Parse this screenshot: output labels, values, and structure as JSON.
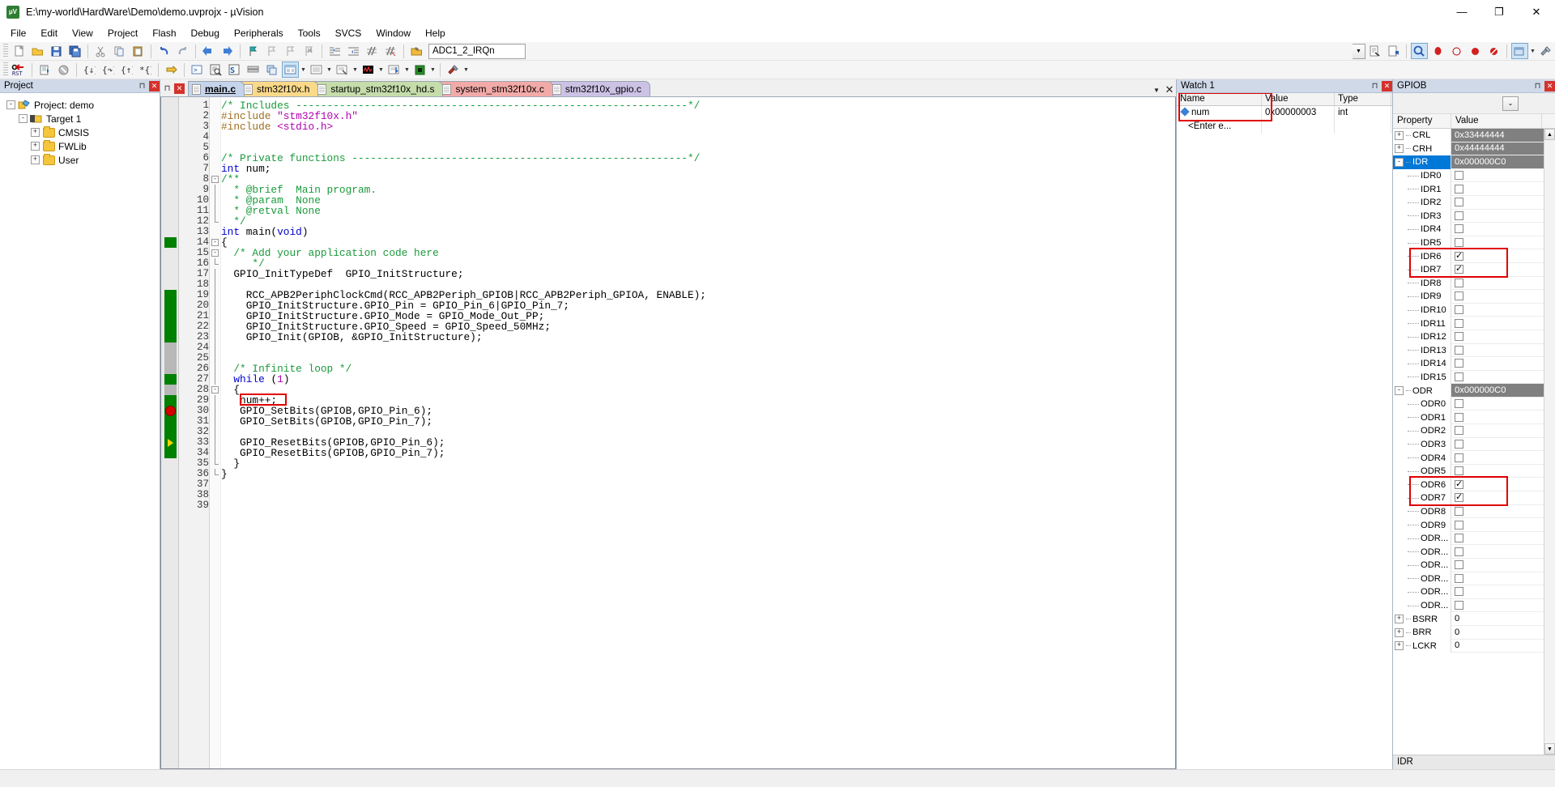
{
  "window": {
    "title": "E:\\my-world\\HardWare\\Demo\\demo.uvprojx - µVision",
    "logo_text": "µV",
    "minimize": "—",
    "maximize": "❐",
    "close": "✕"
  },
  "menu": [
    "File",
    "Edit",
    "View",
    "Project",
    "Flash",
    "Debug",
    "Peripherals",
    "Tools",
    "SVCS",
    "Window",
    "Help"
  ],
  "toolbar1": {
    "combo_value": "ADC1_2_IRQn",
    "icons": [
      "new-file-icon",
      "open-file-icon",
      "save-icon",
      "save-all-icon",
      "cut-icon",
      "copy-icon",
      "paste-icon",
      "undo-icon",
      "redo-icon",
      "navigate-back-icon",
      "navigate-forward-icon",
      "bookmark-toggle-icon",
      "bookmark-prev-icon",
      "bookmark-next-icon",
      "bookmark-clear-icon",
      "indent-icon",
      "outdent-icon",
      "comment-icon",
      "uncomment-icon",
      "insert-function-icon",
      "find-in-files-icon",
      "find-icon",
      "build-target-icon",
      "rebuild-icon",
      "batch-build-icon",
      "download-icon"
    ]
  },
  "toolbar2": {
    "icons": [
      "reset-cpu-icon",
      "debug-session-icon",
      "insert-bp-icon",
      "disable-bp-icon",
      "run-icon",
      "stop-icon",
      "step-into-icon",
      "step-over-icon",
      "step-out-icon",
      "run-to-cursor-icon",
      "show-statement-icon",
      "command-window-icon",
      "disassembly-icon",
      "symbols-icon",
      "registers-icon",
      "call-stack-icon",
      "watch-window-icon",
      "memory-window-icon",
      "serial-window-icon",
      "analysis-window-icon",
      "trace-icon",
      "system-viewer-icon",
      "toolbox-icon"
    ]
  },
  "project": {
    "panel_title": "Project",
    "pin_glyph": "⊓",
    "close_glyph": "✕",
    "tree": [
      {
        "label": "Project: demo",
        "level": 0,
        "expander": "-",
        "icon": "project-icon"
      },
      {
        "label": "Target 1",
        "level": 1,
        "expander": "-",
        "icon": "target-icon"
      },
      {
        "label": "CMSIS",
        "level": 2,
        "expander": "+",
        "icon": "folder-icon"
      },
      {
        "label": "FWLib",
        "level": 2,
        "expander": "+",
        "icon": "folder-icon"
      },
      {
        "label": "User",
        "level": 2,
        "expander": "+",
        "icon": "folder-icon"
      }
    ]
  },
  "editor": {
    "close_glyph": "✕",
    "dropdown_glyph": "▼",
    "tabs": [
      {
        "label": "main.c",
        "color": "#c5d4ea",
        "active": true
      },
      {
        "label": "stm32f10x.h",
        "color": "#fbd98a",
        "active": false
      },
      {
        "label": "startup_stm32f10x_hd.s",
        "color": "#c5dcab",
        "active": false
      },
      {
        "label": "system_stm32f10x.c",
        "color": "#f2aaa8",
        "active": false
      },
      {
        "label": "stm32f10x_gpio.c",
        "color": "#ccc2e5",
        "active": false
      }
    ],
    "lines": [
      {
        "n": 1,
        "tokens": [
          {
            "t": "/* Includes ---------------------------------------------------------------*/",
            "c": "cm"
          }
        ],
        "mark": "none",
        "fold": ""
      },
      {
        "n": 2,
        "tokens": [
          {
            "t": "#include ",
            "c": "pp"
          },
          {
            "t": "\"stm32f10x.h\"",
            "c": "str"
          }
        ],
        "mark": "none",
        "fold": ""
      },
      {
        "n": 3,
        "tokens": [
          {
            "t": "#include ",
            "c": "pp"
          },
          {
            "t": "<stdio.h>",
            "c": "str"
          }
        ],
        "mark": "none",
        "fold": ""
      },
      {
        "n": 4,
        "tokens": [],
        "mark": "none",
        "fold": ""
      },
      {
        "n": 5,
        "tokens": [],
        "mark": "none",
        "fold": ""
      },
      {
        "n": 6,
        "tokens": [
          {
            "t": "/* Private functions ------------------------------------------------------*/",
            "c": "cm"
          }
        ],
        "mark": "none",
        "fold": ""
      },
      {
        "n": 7,
        "tokens": [
          {
            "t": "int ",
            "c": "kw"
          },
          {
            "t": "num;",
            "c": "plain"
          }
        ],
        "mark": "none",
        "fold": ""
      },
      {
        "n": 8,
        "tokens": [
          {
            "t": "/**",
            "c": "cm"
          }
        ],
        "mark": "none",
        "fold": "open"
      },
      {
        "n": 9,
        "tokens": [
          {
            "t": "  * @brief  Main program.",
            "c": "cm"
          }
        ],
        "mark": "none",
        "fold": "bar"
      },
      {
        "n": 10,
        "tokens": [
          {
            "t": "  * @param  None",
            "c": "cm"
          }
        ],
        "mark": "none",
        "fold": "bar"
      },
      {
        "n": 11,
        "tokens": [
          {
            "t": "  * @retval None",
            "c": "cm"
          }
        ],
        "mark": "none",
        "fold": "bar"
      },
      {
        "n": 12,
        "tokens": [
          {
            "t": "  */",
            "c": "cm"
          }
        ],
        "mark": "none",
        "fold": "end"
      },
      {
        "n": 13,
        "tokens": [
          {
            "t": "int ",
            "c": "kw"
          },
          {
            "t": "main(",
            "c": "plain"
          },
          {
            "t": "void",
            "c": "kw"
          },
          {
            "t": ")",
            "c": "plain"
          }
        ],
        "mark": "none",
        "fold": ""
      },
      {
        "n": 14,
        "tokens": [
          {
            "t": "{",
            "c": "plain"
          }
        ],
        "mark": "green",
        "fold": "open"
      },
      {
        "n": 15,
        "tokens": [
          {
            "t": "  /* Add your application code here",
            "c": "cm"
          }
        ],
        "mark": "none",
        "fold": "open2"
      },
      {
        "n": 16,
        "tokens": [
          {
            "t": "     */",
            "c": "cm"
          }
        ],
        "mark": "none",
        "fold": "end2"
      },
      {
        "n": 17,
        "tokens": [
          {
            "t": "  GPIO_InitTypeDef  GPIO_InitStructure;",
            "c": "plain"
          }
        ],
        "mark": "none",
        "fold": "bar"
      },
      {
        "n": 18,
        "tokens": [],
        "mark": "none",
        "fold": "bar"
      },
      {
        "n": 19,
        "tokens": [
          {
            "t": "    RCC_APB2PeriphClockCmd(RCC_APB2Periph_GPIOB|RCC_APB2Periph_GPIOA, ENABLE);",
            "c": "plain"
          }
        ],
        "mark": "green",
        "fold": "bar"
      },
      {
        "n": 20,
        "tokens": [
          {
            "t": "    GPIO_InitStructure.GPIO_Pin = GPIO_Pin_6|GPIO_Pin_7;",
            "c": "plain"
          }
        ],
        "mark": "green",
        "fold": "bar"
      },
      {
        "n": 21,
        "tokens": [
          {
            "t": "    GPIO_InitStructure.GPIO_Mode = GPIO_Mode_Out_PP;",
            "c": "plain"
          }
        ],
        "mark": "green",
        "fold": "bar"
      },
      {
        "n": 22,
        "tokens": [
          {
            "t": "    GPIO_InitStructure.GPIO_Speed = GPIO_Speed_50MHz;",
            "c": "plain"
          }
        ],
        "mark": "green",
        "fold": "bar"
      },
      {
        "n": 23,
        "tokens": [
          {
            "t": "    GPIO_Init(GPIOB, &GPIO_InitStructure);",
            "c": "plain"
          }
        ],
        "mark": "green",
        "fold": "bar"
      },
      {
        "n": 24,
        "tokens": [],
        "mark": "gray",
        "fold": "bar"
      },
      {
        "n": 25,
        "tokens": [],
        "mark": "gray",
        "fold": "bar"
      },
      {
        "n": 26,
        "tokens": [
          {
            "t": "  /* Infinite loop */",
            "c": "cm"
          }
        ],
        "mark": "gray",
        "fold": "bar"
      },
      {
        "n": 27,
        "tokens": [
          {
            "t": "  while ",
            "c": "kw"
          },
          {
            "t": "(",
            "c": "plain"
          },
          {
            "t": "1",
            "c": "kwnum"
          },
          {
            "t": ")",
            "c": "plain"
          }
        ],
        "mark": "green",
        "fold": "bar"
      },
      {
        "n": 28,
        "tokens": [
          {
            "t": "  {",
            "c": "plain"
          }
        ],
        "mark": "gray",
        "fold": "open2"
      },
      {
        "n": 29,
        "tokens": [
          {
            "t": "   num++;",
            "c": "plain"
          }
        ],
        "mark": "green",
        "fold": "bar"
      },
      {
        "n": 30,
        "tokens": [
          {
            "t": "   GPIO_SetBits(GPIOB,GPIO_Pin_6);",
            "c": "plain"
          }
        ],
        "mark": "breakpoint",
        "fold": "bar"
      },
      {
        "n": 31,
        "tokens": [
          {
            "t": "   GPIO_SetBits(GPIOB,GPIO_Pin_7);",
            "c": "plain"
          }
        ],
        "mark": "green",
        "fold": "bar"
      },
      {
        "n": 32,
        "tokens": [],
        "mark": "green",
        "fold": "bar"
      },
      {
        "n": 33,
        "tokens": [
          {
            "t": "   GPIO_ResetBits(GPIOB,GPIO_Pin_6);",
            "c": "plain"
          }
        ],
        "mark": "pc",
        "fold": "bar"
      },
      {
        "n": 34,
        "tokens": [
          {
            "t": "   GPIO_ResetBits(GPIOB,GPIO_Pin_7);",
            "c": "plain"
          }
        ],
        "mark": "green",
        "fold": "bar"
      },
      {
        "n": 35,
        "tokens": [
          {
            "t": "  }",
            "c": "plain"
          }
        ],
        "mark": "none",
        "fold": "end2"
      },
      {
        "n": 36,
        "tokens": [
          {
            "t": "}",
            "c": "plain"
          }
        ],
        "mark": "none",
        "fold": "end"
      },
      {
        "n": 37,
        "tokens": [],
        "mark": "none",
        "fold": ""
      },
      {
        "n": 38,
        "tokens": [],
        "mark": "none",
        "fold": ""
      },
      {
        "n": 39,
        "tokens": [],
        "mark": "none",
        "fold": ""
      }
    ]
  },
  "watch": {
    "panel_title": "Watch 1",
    "pin_glyph": "⊓",
    "close_glyph": "✕",
    "columns": [
      "Name",
      "Value",
      "Type"
    ],
    "rows": [
      {
        "name": "num",
        "value": "0x00000003",
        "type": "int",
        "icon": "watch-var-icon"
      },
      {
        "name": "<Enter e...",
        "value": "",
        "type": "",
        "icon": "none"
      }
    ]
  },
  "peripheral": {
    "panel_title": "GPIOB",
    "pin_glyph": "⊓",
    "close_glyph": "✕",
    "dropdown_glyph": "⌄",
    "columns": [
      "Property",
      "Value"
    ],
    "footer": "IDR",
    "rows": [
      {
        "prop": "CRL",
        "level": 0,
        "expander": "+",
        "value": "0x33444444",
        "kind": "reg"
      },
      {
        "prop": "CRH",
        "level": 0,
        "expander": "+",
        "value": "0x44444444",
        "kind": "reg"
      },
      {
        "prop": "IDR",
        "level": 0,
        "expander": "-",
        "value": "0x000000C0",
        "kind": "reg",
        "selected": true
      },
      {
        "prop": "IDR0",
        "level": 1,
        "expander": "",
        "checked": false,
        "kind": "bit"
      },
      {
        "prop": "IDR1",
        "level": 1,
        "expander": "",
        "checked": false,
        "kind": "bit"
      },
      {
        "prop": "IDR2",
        "level": 1,
        "expander": "",
        "checked": false,
        "kind": "bit"
      },
      {
        "prop": "IDR3",
        "level": 1,
        "expander": "",
        "checked": false,
        "kind": "bit"
      },
      {
        "prop": "IDR4",
        "level": 1,
        "expander": "",
        "checked": false,
        "kind": "bit"
      },
      {
        "prop": "IDR5",
        "level": 1,
        "expander": "",
        "checked": false,
        "kind": "bit"
      },
      {
        "prop": "IDR6",
        "level": 1,
        "expander": "",
        "checked": true,
        "kind": "bit"
      },
      {
        "prop": "IDR7",
        "level": 1,
        "expander": "",
        "checked": true,
        "kind": "bit"
      },
      {
        "prop": "IDR8",
        "level": 1,
        "expander": "",
        "checked": false,
        "kind": "bit"
      },
      {
        "prop": "IDR9",
        "level": 1,
        "expander": "",
        "checked": false,
        "kind": "bit"
      },
      {
        "prop": "IDR10",
        "level": 1,
        "expander": "",
        "checked": false,
        "kind": "bit"
      },
      {
        "prop": "IDR11",
        "level": 1,
        "expander": "",
        "checked": false,
        "kind": "bit"
      },
      {
        "prop": "IDR12",
        "level": 1,
        "expander": "",
        "checked": false,
        "kind": "bit"
      },
      {
        "prop": "IDR13",
        "level": 1,
        "expander": "",
        "checked": false,
        "kind": "bit"
      },
      {
        "prop": "IDR14",
        "level": 1,
        "expander": "",
        "checked": false,
        "kind": "bit"
      },
      {
        "prop": "IDR15",
        "level": 1,
        "expander": "",
        "checked": false,
        "kind": "bit"
      },
      {
        "prop": "ODR",
        "level": 0,
        "expander": "-",
        "value": "0x000000C0",
        "kind": "reg"
      },
      {
        "prop": "ODR0",
        "level": 1,
        "expander": "",
        "checked": false,
        "kind": "bit"
      },
      {
        "prop": "ODR1",
        "level": 1,
        "expander": "",
        "checked": false,
        "kind": "bit"
      },
      {
        "prop": "ODR2",
        "level": 1,
        "expander": "",
        "checked": false,
        "kind": "bit"
      },
      {
        "prop": "ODR3",
        "level": 1,
        "expander": "",
        "checked": false,
        "kind": "bit"
      },
      {
        "prop": "ODR4",
        "level": 1,
        "expander": "",
        "checked": false,
        "kind": "bit"
      },
      {
        "prop": "ODR5",
        "level": 1,
        "expander": "",
        "checked": false,
        "kind": "bit"
      },
      {
        "prop": "ODR6",
        "level": 1,
        "expander": "",
        "checked": true,
        "kind": "bit"
      },
      {
        "prop": "ODR7",
        "level": 1,
        "expander": "",
        "checked": true,
        "kind": "bit"
      },
      {
        "prop": "ODR8",
        "level": 1,
        "expander": "",
        "checked": false,
        "kind": "bit"
      },
      {
        "prop": "ODR9",
        "level": 1,
        "expander": "",
        "checked": false,
        "kind": "bit"
      },
      {
        "prop": "ODR...",
        "level": 1,
        "expander": "",
        "checked": false,
        "kind": "bit"
      },
      {
        "prop": "ODR...",
        "level": 1,
        "expander": "",
        "checked": false,
        "kind": "bit"
      },
      {
        "prop": "ODR...",
        "level": 1,
        "expander": "",
        "checked": false,
        "kind": "bit"
      },
      {
        "prop": "ODR...",
        "level": 1,
        "expander": "",
        "checked": false,
        "kind": "bit"
      },
      {
        "prop": "ODR...",
        "level": 1,
        "expander": "",
        "checked": false,
        "kind": "bit"
      },
      {
        "prop": "ODR...",
        "level": 1,
        "expander": "",
        "checked": false,
        "kind": "bit"
      },
      {
        "prop": "BSRR",
        "level": 0,
        "expander": "+",
        "value": "0",
        "kind": "reg0"
      },
      {
        "prop": "BRR",
        "level": 0,
        "expander": "+",
        "value": "0",
        "kind": "reg0"
      },
      {
        "prop": "LCKR",
        "level": 0,
        "expander": "+",
        "value": "0",
        "kind": "reg0"
      }
    ]
  },
  "highlights": {
    "accent": "#e00000",
    "note": "red annotation boxes around num++, watch num row, IDR6/IDR7, ODR6/ODR7"
  }
}
